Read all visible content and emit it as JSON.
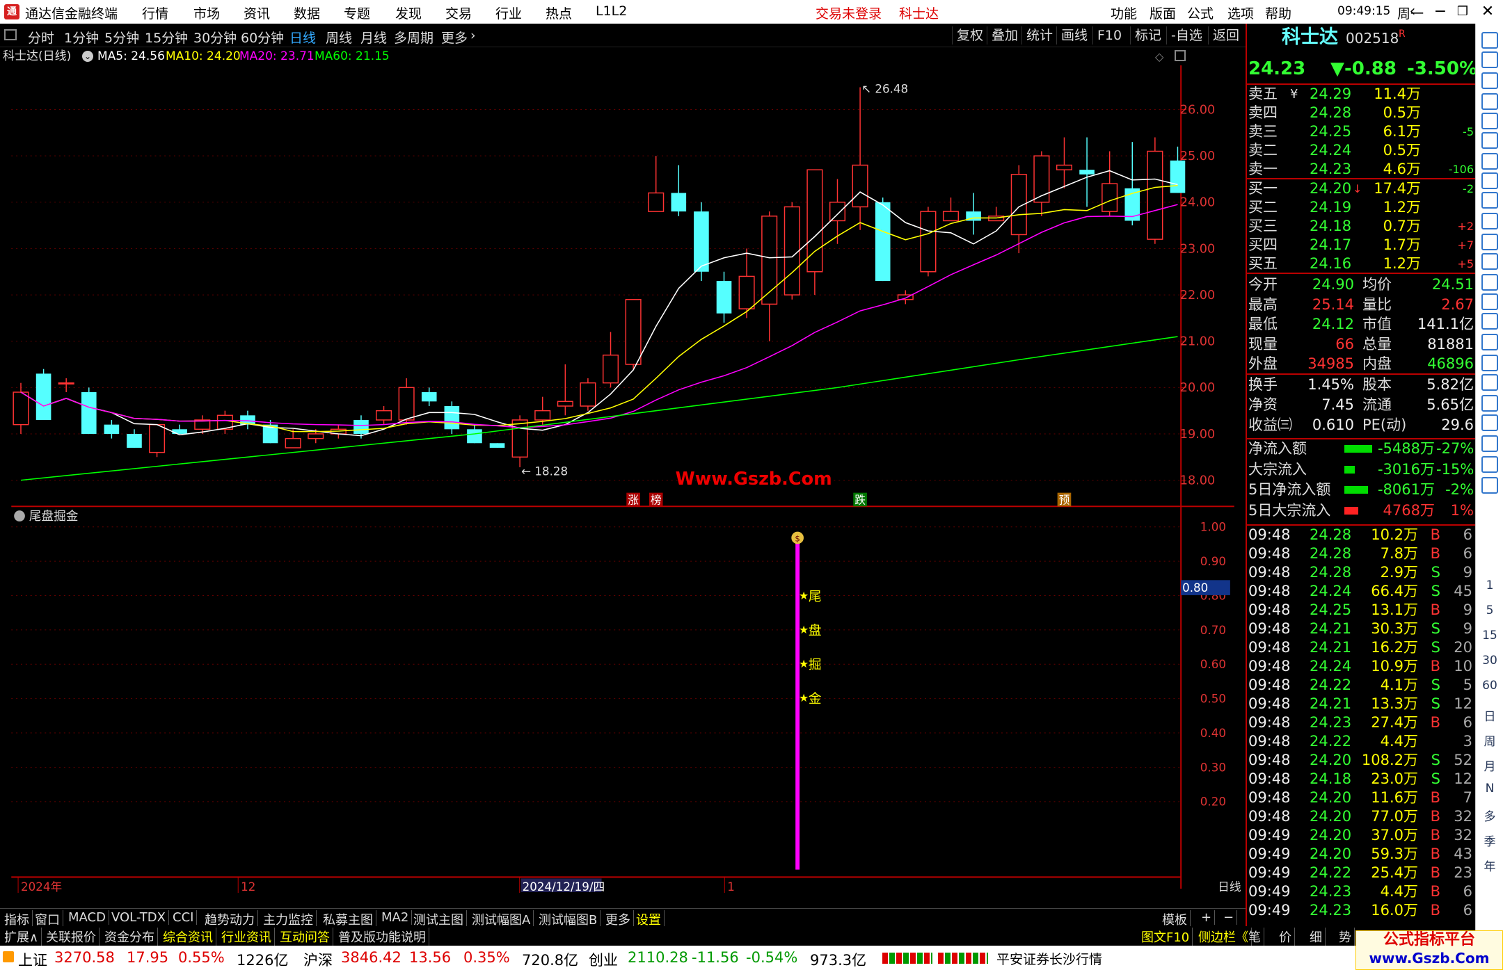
{
  "titlebar": {
    "app_title": "通达信金融终端",
    "menus": [
      "行情",
      "市场",
      "资讯",
      "数据",
      "专题",
      "发现",
      "交易",
      "行业",
      "热点",
      "L1L2"
    ],
    "login_status": "交易未登录",
    "stock_name": "科士达",
    "right_menus": [
      "功能",
      "版面",
      "公式",
      "选项",
      "帮助"
    ],
    "clock": "09:49:15",
    "weekday": "周一"
  },
  "periods": [
    "分时",
    "1分钟",
    "5分钟",
    "15分钟",
    "30分钟",
    "60分钟",
    "日线",
    "周线",
    "月线",
    "多周期",
    "更多"
  ],
  "active_period": "日线",
  "toolbar_right": [
    "复权",
    "叠加",
    "统计",
    "画线",
    "F10",
    "标记",
    "-自选",
    "返回"
  ],
  "ma_line": {
    "name": "科士达(日线)",
    "ma5": "MA5: 24.56",
    "ma10": "MA10: 24.20",
    "ma20": "MA20: 23.71",
    "ma60": "MA60: 21.15"
  },
  "colors": {
    "ma5": "#ffffff",
    "ma10": "#ffff00",
    "ma20": "#ff00ff",
    "ma60": "#00ff00",
    "up": "#ff3333",
    "down": "#55ffff"
  },
  "chart_data": {
    "type": "candlestick",
    "title": "科士达(日线)",
    "ylim": [
      17.7,
      26.6
    ],
    "yticks": [
      "26.00",
      "25.00",
      "24.00",
      "23.00",
      "22.00",
      "21.00",
      "20.00",
      "19.00",
      "18.00"
    ],
    "ytick_values": [
      26,
      25,
      24,
      23,
      22,
      21,
      20,
      19,
      18
    ],
    "high_label": "26.48",
    "low_label": "18.28",
    "markers": [
      {
        "text": "涨",
        "idx": 27
      },
      {
        "text": "榜",
        "idx": 28
      },
      {
        "text": "跌",
        "idx": 37
      },
      {
        "text": "预",
        "idx": 46
      }
    ],
    "watermark": "Www.Gszb.Com",
    "candles": [
      [
        19.2,
        19.9,
        19.0,
        20.1
      ],
      [
        20.3,
        19.3,
        19.3,
        20.4
      ],
      [
        20.1,
        20.1,
        19.9,
        20.2
      ],
      [
        19.9,
        19.0,
        19.0,
        20.0
      ],
      [
        19.2,
        19.0,
        18.9,
        19.3
      ],
      [
        19.0,
        18.7,
        18.7,
        19.1
      ],
      [
        18.6,
        19.2,
        18.5,
        19.2
      ],
      [
        19.1,
        19.0,
        19.0,
        19.2
      ],
      [
        19.1,
        19.3,
        19.0,
        19.4
      ],
      [
        19.1,
        19.4,
        19.0,
        19.5
      ],
      [
        19.4,
        19.2,
        19.1,
        19.5
      ],
      [
        19.2,
        18.8,
        18.8,
        19.3
      ],
      [
        18.7,
        18.9,
        18.7,
        19.1
      ],
      [
        18.9,
        19.0,
        18.8,
        19.1
      ],
      [
        19.0,
        19.1,
        18.9,
        19.2
      ],
      [
        19.3,
        19.0,
        18.9,
        19.4
      ],
      [
        19.3,
        19.5,
        19.2,
        19.6
      ],
      [
        19.3,
        20.0,
        19.2,
        20.2
      ],
      [
        19.9,
        19.7,
        19.6,
        20.0
      ],
      [
        19.6,
        19.1,
        19.0,
        19.7
      ],
      [
        19.1,
        18.8,
        18.8,
        19.2
      ],
      [
        18.8,
        18.7,
        18.7,
        18.8
      ],
      [
        18.5,
        19.3,
        18.28,
        19.4
      ],
      [
        19.3,
        19.5,
        19.2,
        19.8
      ],
      [
        19.6,
        19.7,
        19.4,
        20.5
      ],
      [
        19.6,
        20.1,
        19.5,
        20.2
      ],
      [
        20.1,
        20.7,
        20.0,
        21.2
      ],
      [
        20.5,
        21.9,
        20.4,
        21.9
      ],
      [
        23.8,
        24.2,
        23.8,
        25.0
      ],
      [
        24.2,
        23.8,
        23.7,
        24.8
      ],
      [
        23.8,
        22.5,
        22.3,
        24.0
      ],
      [
        22.3,
        21.6,
        21.4,
        22.5
      ],
      [
        21.7,
        22.4,
        21.5,
        23.0
      ],
      [
        21.8,
        23.7,
        21.0,
        23.8
      ],
      [
        22.0,
        23.9,
        21.9,
        24.0
      ],
      [
        22.5,
        24.7,
        22.0,
        24.7
      ],
      [
        23.6,
        24.0,
        23.1,
        24.5
      ],
      [
        23.9,
        24.8,
        23.4,
        26.48
      ],
      [
        24.0,
        22.3,
        22.3,
        24.1
      ],
      [
        21.9,
        22.0,
        21.8,
        22.1
      ],
      [
        22.5,
        23.8,
        22.4,
        23.9
      ],
      [
        23.6,
        23.8,
        23.6,
        24.1
      ],
      [
        23.8,
        23.6,
        23.3,
        24.2
      ],
      [
        23.6,
        23.7,
        23.6,
        23.9
      ],
      [
        23.3,
        24.6,
        22.9,
        24.8
      ],
      [
        24.0,
        25.0,
        23.7,
        25.1
      ],
      [
        24.7,
        24.8,
        24.3,
        25.4
      ],
      [
        24.7,
        24.6,
        23.9,
        25.4
      ],
      [
        23.8,
        24.4,
        23.7,
        25.1
      ],
      [
        24.3,
        23.6,
        23.5,
        25.3
      ],
      [
        23.2,
        25.1,
        23.1,
        25.4
      ],
      [
        24.9,
        24.2,
        24.2,
        25.2
      ]
    ],
    "ma60_points": [
      [
        0,
        18.0
      ],
      [
        10,
        18.5
      ],
      [
        20,
        19.0
      ],
      [
        28,
        19.5
      ],
      [
        36,
        20.0
      ],
      [
        44,
        20.6
      ],
      [
        51,
        21.1
      ]
    ],
    "x_labels": [
      "2024年",
      "12",
      "2024/12/19/四",
      "1",
      "日线"
    ]
  },
  "sub_chart": {
    "title": "尾盘掘金",
    "yticks": [
      "1.00",
      "0.90",
      "0.80",
      "0.70",
      "0.60",
      "0.50",
      "0.40",
      "0.30",
      "0.20"
    ],
    "current_value": "0.80",
    "signal_chars": [
      "尾",
      "盘",
      "掘",
      "金"
    ]
  },
  "quote": {
    "name": "科士达",
    "code": "002518",
    "flag": "R",
    "price": "24.23",
    "change": "▼-0.88",
    "change_pct": "-3.50%",
    "asks": [
      {
        "label": "卖五",
        "tag": "¥",
        "price": "24.29",
        "vol": "11.4万",
        "chg": ""
      },
      {
        "label": "卖四",
        "tag": "",
        "price": "24.28",
        "vol": "0.5万",
        "chg": ""
      },
      {
        "label": "卖三",
        "tag": "",
        "price": "24.25",
        "vol": "6.1万",
        "chg": "-5"
      },
      {
        "label": "卖二",
        "tag": "",
        "price": "24.24",
        "vol": "0.5万",
        "chg": ""
      },
      {
        "label": "卖一",
        "tag": "",
        "price": "24.23",
        "vol": "4.6万",
        "chg": "-106"
      }
    ],
    "bids": [
      {
        "label": "买一",
        "tag": "↓",
        "price": "24.20",
        "vol": "17.4万",
        "chg": "-2"
      },
      {
        "label": "买二",
        "tag": "",
        "price": "24.19",
        "vol": "1.2万",
        "chg": ""
      },
      {
        "label": "买三",
        "tag": "",
        "price": "24.18",
        "vol": "0.7万",
        "chg": "+2"
      },
      {
        "label": "买四",
        "tag": "",
        "price": "24.17",
        "vol": "1.7万",
        "chg": "+7"
      },
      {
        "label": "买五",
        "tag": "",
        "price": "24.16",
        "vol": "1.2万",
        "chg": "+5"
      }
    ],
    "stats1": [
      {
        "l1": "今开",
        "v1": "24.90",
        "l2": "均价",
        "v2": "24.51"
      },
      {
        "l1": "最高",
        "v1": "25.14",
        "l2": "量比",
        "v2": "2.67"
      },
      {
        "l1": "最低",
        "v1": "24.12",
        "l2": "市值",
        "v2": "141.1亿"
      },
      {
        "l1": "现量",
        "v1": "66",
        "l2": "总量",
        "v2": "81881"
      },
      {
        "l1": "外盘",
        "v1": "34985",
        "l2": "内盘",
        "v2": "46896"
      }
    ],
    "stats2": [
      {
        "l1": "换手",
        "v1": "1.45%",
        "l2": "股本",
        "v2": "5.82亿"
      },
      {
        "l1": "净资",
        "v1": "7.45",
        "l2": "流通",
        "v2": "5.65亿"
      },
      {
        "l1": "收益㈢",
        "v1": "0.610",
        "l2": "PE(动)",
        "v2": "29.6"
      }
    ],
    "flows": [
      {
        "l": "净流入额",
        "v": "-5488万",
        "p": "-27%",
        "bar": 40,
        "color": "green"
      },
      {
        "l": "大宗流入",
        "v": "-3016万",
        "p": "-15%",
        "bar": 15,
        "color": "green"
      },
      {
        "l": "5日净流入额",
        "v": "-8061万",
        "p": "-2%",
        "bar": 34,
        "color": "green"
      },
      {
        "l": "5日大宗流入",
        "v": "4768万",
        "p": "1%",
        "bar": 20,
        "color": "red"
      }
    ],
    "ticks": [
      [
        "09:48",
        "24.28",
        "10.2万",
        "B",
        "6"
      ],
      [
        "09:48",
        "24.28",
        "7.8万",
        "B",
        "6"
      ],
      [
        "09:48",
        "24.28",
        "2.9万",
        "S",
        "9"
      ],
      [
        "09:48",
        "24.24",
        "66.4万",
        "S",
        "45"
      ],
      [
        "09:48",
        "24.25",
        "13.1万",
        "B",
        "9"
      ],
      [
        "09:48",
        "24.21",
        "30.3万",
        "S",
        "9"
      ],
      [
        "09:48",
        "24.21",
        "16.2万",
        "S",
        "20"
      ],
      [
        "09:48",
        "24.24",
        "10.9万",
        "B",
        "10"
      ],
      [
        "09:48",
        "24.22",
        "4.1万",
        "S",
        "5"
      ],
      [
        "09:48",
        "24.21",
        "13.3万",
        "S",
        "12"
      ],
      [
        "09:48",
        "24.23",
        "27.4万",
        "B",
        "6"
      ],
      [
        "09:48",
        "24.22",
        "4.4万",
        "",
        "3"
      ],
      [
        "09:48",
        "24.20",
        "108.2万",
        "S",
        "52"
      ],
      [
        "09:48",
        "24.18",
        "23.0万",
        "S",
        "12"
      ],
      [
        "09:48",
        "24.20",
        "11.6万",
        "B",
        "7"
      ],
      [
        "09:48",
        "24.20",
        "77.0万",
        "B",
        "32"
      ],
      [
        "09:49",
        "24.20",
        "37.0万",
        "B",
        "32"
      ],
      [
        "09:49",
        "24.20",
        "59.3万",
        "B",
        "43"
      ],
      [
        "09:49",
        "24.22",
        "25.4万",
        "B",
        "23"
      ],
      [
        "09:49",
        "24.23",
        "4.4万",
        "B",
        "6"
      ],
      [
        "09:49",
        "24.23",
        "16.0万",
        "B",
        "6"
      ]
    ]
  },
  "sidebar_labels": [
    "1",
    "5",
    "15",
    "30",
    "60",
    "日",
    "周",
    "月",
    "N",
    "多",
    "季",
    "年"
  ],
  "tabs1": [
    "指标",
    "窗口",
    "MACD",
    "VOL-TDX",
    "CCI",
    "趋势动力",
    "主力监控",
    "私募主图",
    "MA2",
    "测试主图",
    "测试幅图A",
    "测试幅图B",
    "更多",
    "设置"
  ],
  "tabs1_active": "设置",
  "tabs1_right": [
    "模板",
    "+",
    "−"
  ],
  "tabs2": [
    "扩展∧",
    "关联报价",
    "资金分布",
    "综合资讯",
    "行业资讯",
    "互动问答",
    "普及版功能说明"
  ],
  "tabs2_right": [
    "图文F10",
    "侧边栏《",
    "笔",
    "价",
    "细",
    "势"
  ],
  "status": {
    "sh_label": "上证",
    "sh_val": "3270.58",
    "sh_chg": "17.95",
    "sh_pct": "0.55%",
    "sh_amt": "1226亿",
    "hs_label": "沪深",
    "hs_val": "3846.42",
    "hs_chg": "13.56",
    "hs_pct": "0.35%",
    "hs_amt": "720.8亿",
    "cy_label": "创业",
    "cy_val": "2110.28",
    "cy_chg": "-11.56",
    "cy_pct": "-0.54%",
    "cy_amt": "973.3亿",
    "broker": "平安证券长沙行情"
  },
  "watermark_badge": {
    "title": "公式指标平台",
    "url": "www.Gszb.Com"
  }
}
